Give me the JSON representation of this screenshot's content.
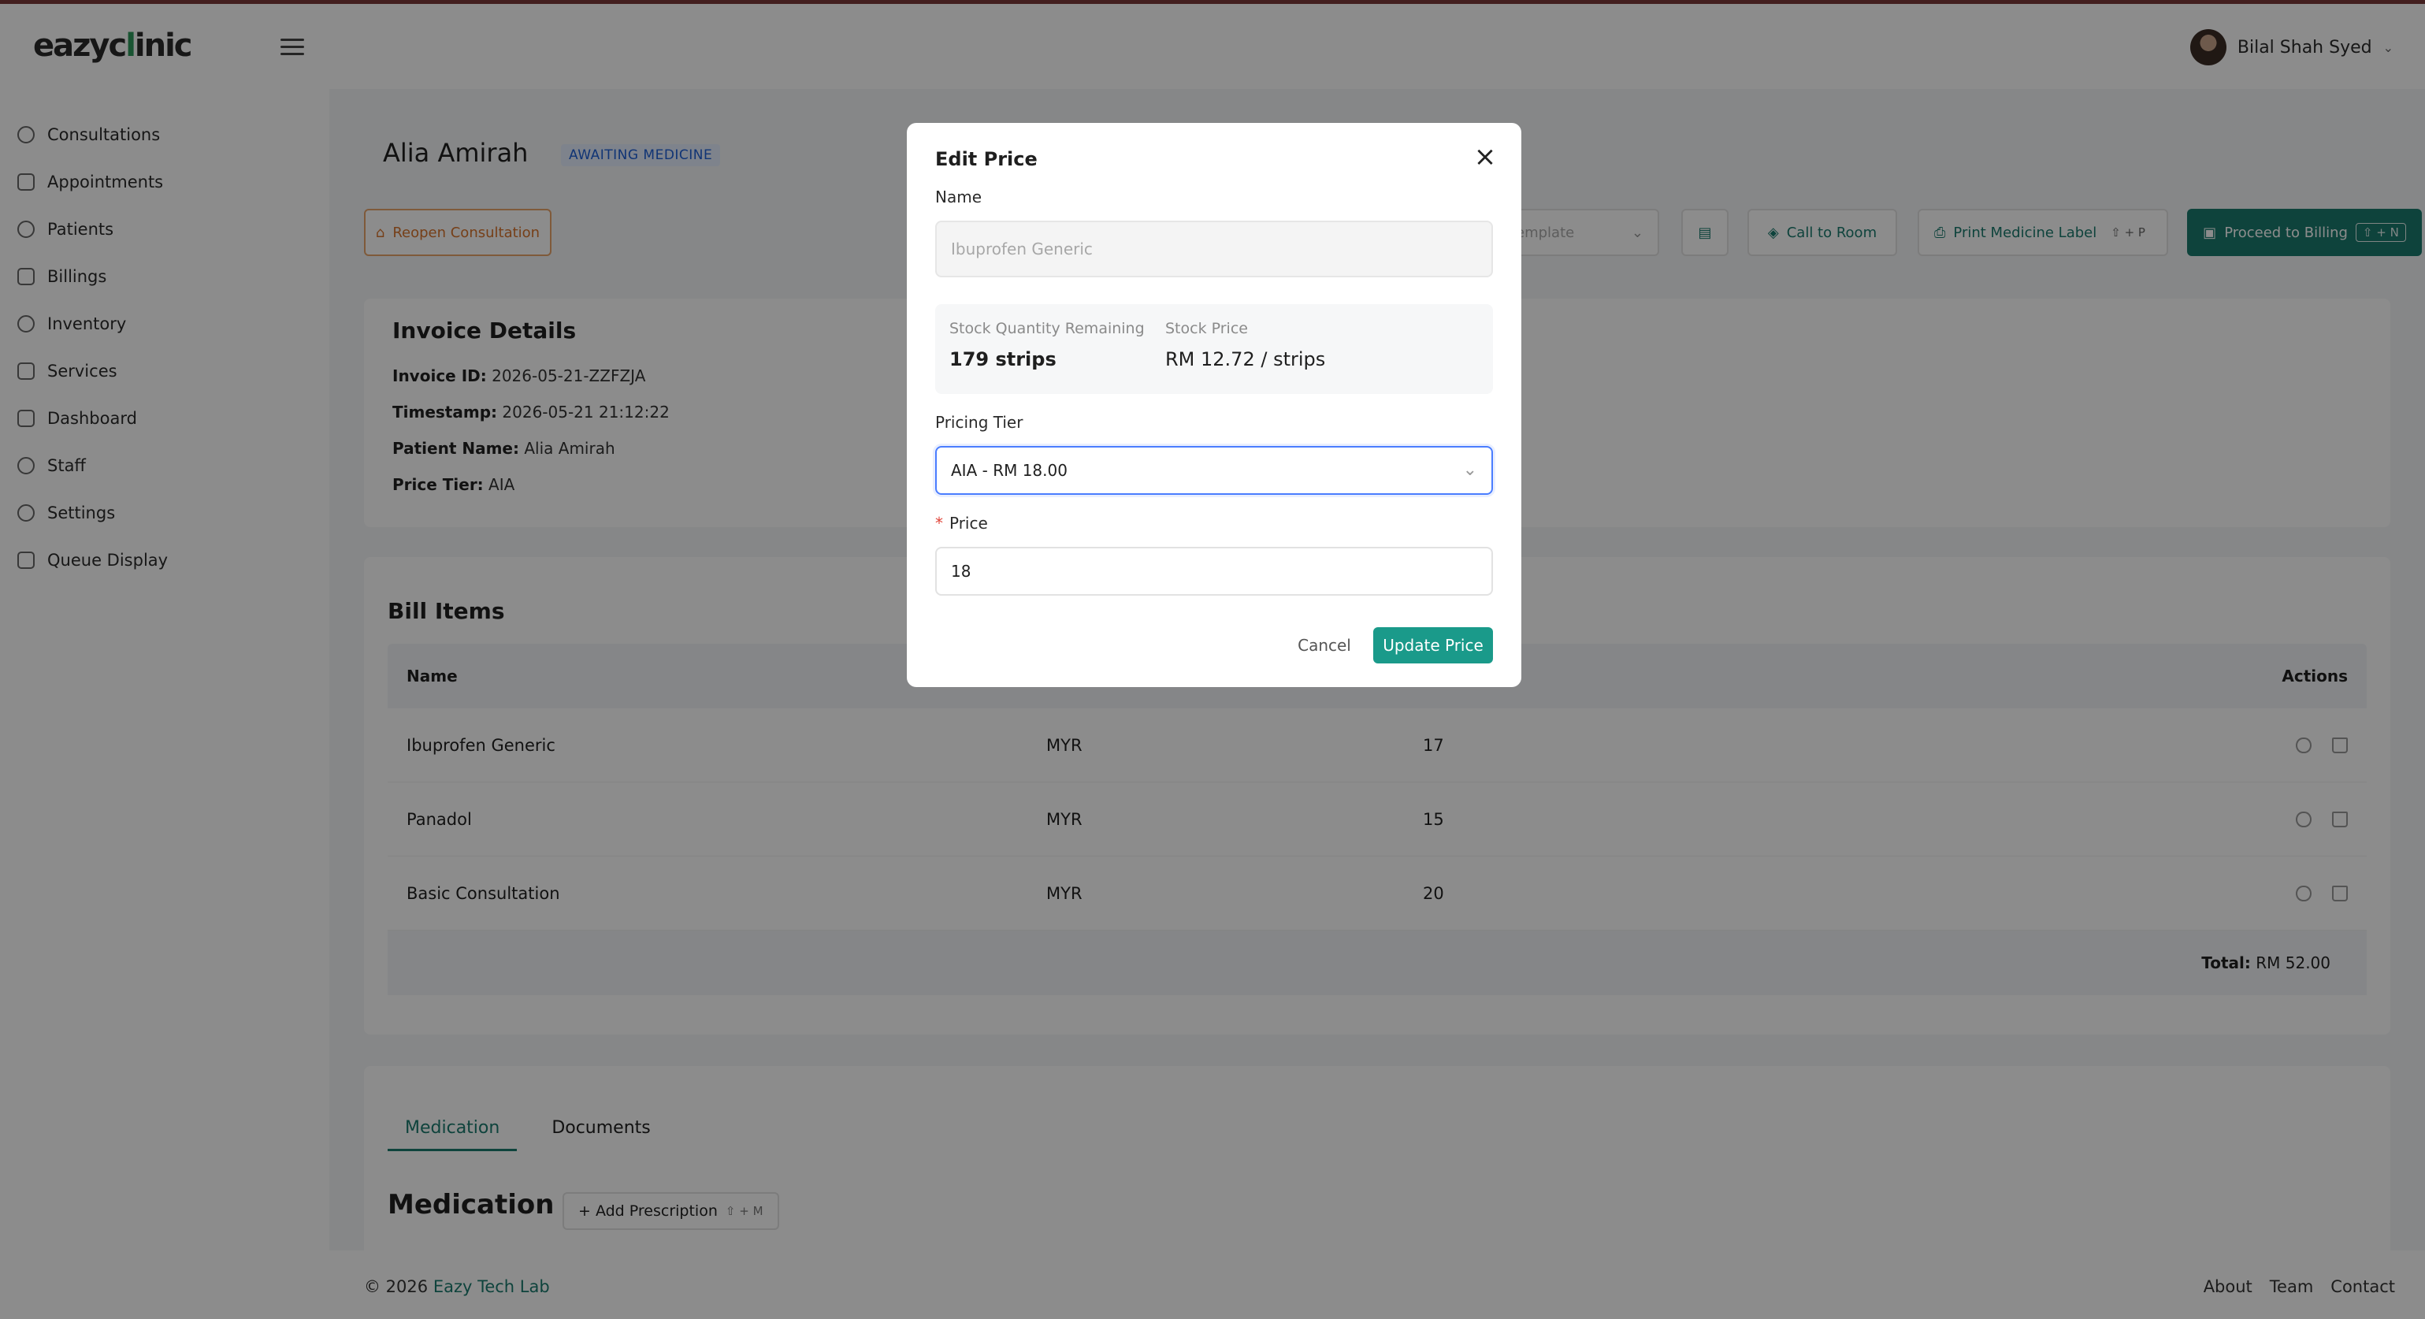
{
  "app": {
    "logo_text": "eazyc",
    "logo_text_end": "inic",
    "logo_leaf": "l"
  },
  "header": {
    "user_name": "Bilal Shah Syed"
  },
  "sidebar": {
    "items": [
      {
        "label": "Consultations",
        "icon": "stethoscope-icon"
      },
      {
        "label": "Appointments",
        "icon": "calendar-icon"
      },
      {
        "label": "Patients",
        "icon": "smile-icon"
      },
      {
        "label": "Billings",
        "icon": "billing-icon"
      },
      {
        "label": "Inventory",
        "icon": "pill-icon"
      },
      {
        "label": "Services",
        "icon": "services-icon"
      },
      {
        "label": "Dashboard",
        "icon": "dashboard-icon"
      },
      {
        "label": "Staff",
        "icon": "staff-icon"
      },
      {
        "label": "Settings",
        "icon": "gear-icon"
      },
      {
        "label": "Queue Display",
        "icon": "monitor-icon"
      }
    ]
  },
  "page": {
    "patient_name": "Alia Amirah",
    "status": "AWAITING MEDICINE",
    "reopen_label": "Reopen Consultation",
    "template_placeholder": "emplate",
    "call_room_label": "Call to Room",
    "print_label": "Print Medicine Label",
    "print_shortcut": "⇧ + P",
    "billing_label": "Proceed to Billing",
    "billing_shortcut": "⇧ + N"
  },
  "invoice": {
    "title": "Invoice Details",
    "id_label": "Invoice ID:",
    "id_value": "2026-05-21-ZZFZJA",
    "timestamp_label": "Timestamp:",
    "timestamp_value": "2026-05-21 21:12:22",
    "patient_label": "Patient Name:",
    "patient_value": "Alia Amirah",
    "tier_label": "Price Tier:",
    "tier_value": "AIA"
  },
  "bill": {
    "title": "Bill Items",
    "headers": {
      "name": "Name",
      "actions": "Actions"
    },
    "rows": [
      {
        "name": "Ibuprofen Generic",
        "currency": "MYR",
        "price": "17"
      },
      {
        "name": "Panadol",
        "currency": "MYR",
        "price": "15"
      },
      {
        "name": "Basic Consultation",
        "currency": "MYR",
        "price": "20"
      }
    ],
    "total_label": "Total:",
    "total_value": "RM 52.00"
  },
  "medication": {
    "tabs": [
      "Medication",
      "Documents"
    ],
    "title": "Medication",
    "add_label": "+ Add Prescription",
    "add_shortcut": "⇧ + M"
  },
  "footer": {
    "copyright": "© 2026",
    "brand": "Eazy Tech Lab",
    "links": [
      "About",
      "Team",
      "Contact"
    ]
  },
  "modal": {
    "title": "Edit Price",
    "name_label": "Name",
    "name_value": "Ibuprofen Generic",
    "stock_qty_label": "Stock Quantity Remaining",
    "stock_qty_value": "179 strips",
    "stock_price_label": "Stock Price",
    "stock_price_value": "RM 12.72 / strips",
    "tier_label": "Pricing Tier",
    "tier_value": "AIA - RM 18.00",
    "price_label": "Price",
    "price_value": "18",
    "cancel_label": "Cancel",
    "update_label": "Update Price"
  }
}
